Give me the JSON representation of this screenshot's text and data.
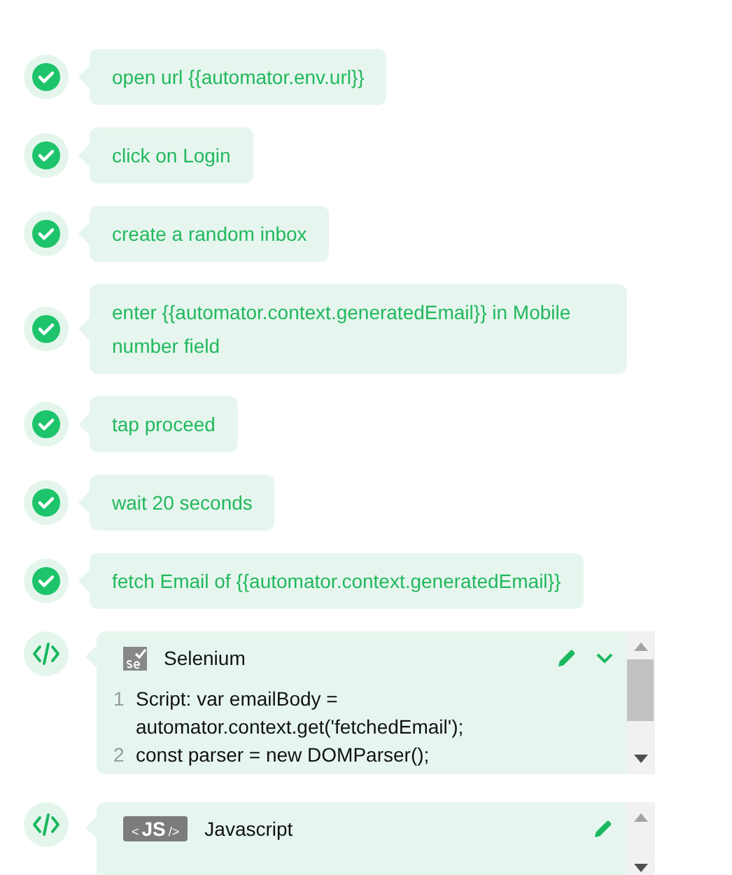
{
  "steps": [
    {
      "kind": "action",
      "passed": true,
      "text": "open url {{automator.env.url}}"
    },
    {
      "kind": "action",
      "passed": true,
      "text": "click on Login"
    },
    {
      "kind": "action",
      "passed": true,
      "text": "create a random inbox"
    },
    {
      "kind": "action",
      "passed": true,
      "text": "enter {{automator.context.generatedEmail}} in Mobile number field"
    },
    {
      "kind": "action",
      "passed": true,
      "text": "tap proceed"
    },
    {
      "kind": "action",
      "passed": true,
      "text": "wait 20 seconds"
    },
    {
      "kind": "action",
      "passed": true,
      "text": "fetch Email of {{automator.context.generatedEmail}}"
    },
    {
      "kind": "selenium",
      "title": "Selenium",
      "collapsible": true,
      "lines": [
        {
          "number": "1",
          "code": "Script: var emailBody = automator.context.get('fetchedEmail');"
        },
        {
          "number": "2",
          "code": "const parser = new DOMParser();"
        }
      ]
    },
    {
      "kind": "javascript",
      "title": "Javascript",
      "badge": {
        "open": "<",
        "label": "JS",
        "close": "/>"
      },
      "collapsible": false
    }
  ]
}
